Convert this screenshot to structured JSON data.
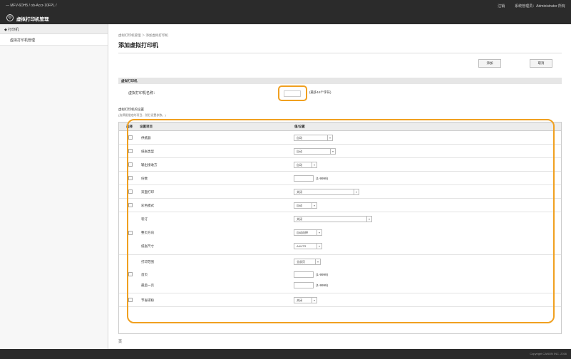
{
  "header": {
    "breadcrumb": "— MFV-6DH5 / ob-Accr-10FPL /",
    "app_icon": "gear-logo-icon",
    "app_title": "虚拟打印机管理",
    "logout": "注销",
    "user": "系统管理员：Administrator 所有"
  },
  "sidebar": {
    "back_label": "◆ 打印机",
    "items": [
      {
        "label": "虚拟打印机管理"
      }
    ]
  },
  "main": {
    "breadcrumb": "虚拟打印机管理 ＞ 添加虚拟打印机",
    "title": "添加虚拟打印机",
    "ok_label": "添加",
    "cancel_label": "取消",
    "section_title": "虚拟打印机",
    "name_label": "虚拟打印机名称：",
    "name_value": "",
    "name_hint": "(最多16个字符)",
    "settings_title": "虚拟打印机的设置",
    "settings_note": "(选择要指定的项目，然后设置参数。)",
    "table": {
      "col_select": "选择",
      "col_item": "设置项目",
      "col_value": "值/设置",
      "rows": [
        {
          "label": "供纸器",
          "control": "select",
          "value": "自动"
        },
        {
          "label": "纸张类型",
          "control": "select",
          "value": "自动"
        },
        {
          "label": "输出接收方",
          "control": "select",
          "value": "自动"
        },
        {
          "label": "份数",
          "control": "text",
          "range": "(1-9999)"
        },
        {
          "label": "双面打印",
          "control": "select",
          "value": "关闭"
        },
        {
          "label": "彩色模式",
          "control": "select",
          "value": "自动"
        },
        {
          "label": "装订",
          "control": "select",
          "value": "关闭"
        },
        {
          "label": "整页方向",
          "control": "select",
          "value": "自动选择"
        },
        {
          "label": "纸张尺寸",
          "control": "select",
          "value": "A4/LTR"
        },
        {
          "label": "打印范围",
          "control": "select",
          "value": "全部页"
        },
        {
          "label": "首页",
          "control": "text",
          "range": "(1-9999)"
        },
        {
          "label": "最后一页",
          "control": "text",
          "range": "(1-9999)"
        },
        {
          "label": "节省碳粉",
          "control": "select",
          "value": "关闭"
        }
      ]
    },
    "footer_note": "页"
  },
  "footer": {
    "copyright": "Copyright CANON INC. 2016"
  },
  "colors": {
    "highlight": "#f0a020",
    "topbar": "#2b2b2b"
  }
}
